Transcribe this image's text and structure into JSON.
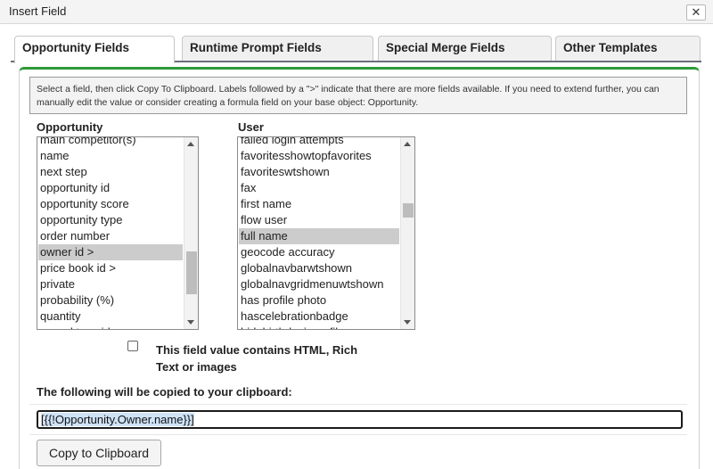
{
  "window": {
    "title": "Insert Field",
    "close_label": "✕"
  },
  "tabs": [
    {
      "label": "Opportunity Fields",
      "active": true
    },
    {
      "label": "Runtime Prompt Fields",
      "active": false
    },
    {
      "label": "Special Merge Fields",
      "active": false
    },
    {
      "label": "Other Templates",
      "active": false
    }
  ],
  "instructions": "Select a field, then click Copy To Clipboard. Labels followed by a \">\" indicate that there are more fields available. If you need to extend further, you can manually edit the value or consider creating a formula field on your base object: Opportunity.",
  "opportunity_list": {
    "label": "Opportunity",
    "items": [
      "main competitor(s)",
      "name",
      "next step",
      "opportunity id",
      "opportunity score",
      "opportunity type",
      "order number",
      "owner id >",
      "price book id >",
      "private",
      "probability (%)",
      "quantity",
      "record type id"
    ],
    "selected_index": 7
  },
  "user_list": {
    "label": "User",
    "items": [
      "failed login attempts",
      "favoritesshowtopfavorites",
      "favoriteswtshown",
      "fax",
      "first name",
      "flow user",
      "full name",
      "geocode accuracy",
      "globalnavbarwtshown",
      "globalnavgridmenuwtshown",
      "has profile photo",
      "hascelebrationbadge",
      "hidebirthdayinprofile"
    ],
    "selected_index": 6
  },
  "html_checkbox": {
    "label": "This field value contains HTML, Rich Text or images",
    "checked": false
  },
  "clipboard_label": "The following will be copied to your clipboard:",
  "merge_field_value": "[{{!Opportunity.Owner.name}}]",
  "copy_button_label": "Copy to Clipboard",
  "colors": {
    "panel_accent": "#2e9a3a",
    "selection": "#cccccc",
    "highlight": "#cfe3f7"
  }
}
